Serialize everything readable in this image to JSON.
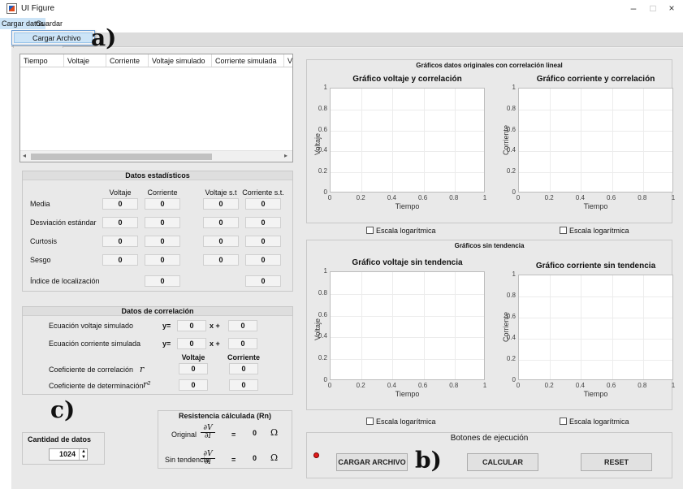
{
  "window": {
    "title": "UI Figure",
    "minimize": "–",
    "maximize": "□",
    "close": "×"
  },
  "menu": {
    "items": [
      "Cargar datos",
      "Guardar"
    ],
    "dropdown_item": "Cargar Archivo"
  },
  "annotations": {
    "a": "a)",
    "b": "b)",
    "c": "c)"
  },
  "table": {
    "columns": [
      "Tiempo",
      "Voltaje",
      "Corriente",
      "Voltaje simulado",
      "Corriente simulada",
      "Vo"
    ]
  },
  "stats": {
    "title": "Datos estadísticos",
    "col_headers": [
      "Voltaje",
      "Corriente",
      "Voltaje s.t",
      "Corriente s.t."
    ],
    "rows": [
      {
        "label": "Media",
        "values": [
          "0",
          "0",
          "0",
          "0"
        ]
      },
      {
        "label": "Desviación estándar",
        "values": [
          "0",
          "0",
          "0",
          "0"
        ]
      },
      {
        "label": "Curtosis",
        "values": [
          "0",
          "0",
          "0",
          "0"
        ]
      },
      {
        "label": "Sesgo",
        "values": [
          "0",
          "0",
          "0",
          "0"
        ]
      },
      {
        "label": "Índice de localización",
        "values": [
          "",
          "0",
          "",
          "0"
        ]
      }
    ]
  },
  "correlation": {
    "title": "Datos de correlación",
    "eq_v_label": "Ecuación voltaje simulado",
    "eq_i_label": "Ecuación corriente simulada",
    "y_eq": "y=",
    "x_plus": "x +",
    "eq_v_values": [
      "0",
      "0"
    ],
    "eq_i_values": [
      "0",
      "0"
    ],
    "col_headers": [
      "Voltaje",
      "Corriente"
    ],
    "coef_corr_label": "Coeficiente de correlación",
    "coef_corr_sym": "r",
    "coef_corr_values": [
      "0",
      "0"
    ],
    "coef_det_label": "Coeficiente de determinación",
    "coef_det_sym": "r²",
    "coef_det_values": [
      "0",
      "0"
    ]
  },
  "quantity": {
    "label": "Cantidad de datos",
    "value": "1024"
  },
  "resistance": {
    "title": "Resistencia cálculada (Rn)",
    "original_label": "Original",
    "sin_tendencia_label": "Sin tendencia",
    "frac_num": "∂V",
    "frac_den": "∂I",
    "equals": "=",
    "original_value": "0",
    "sin_tendencia_value": "0",
    "unit": "Ω"
  },
  "charts_original": {
    "title": "Gráficos datos originales con correlación lineal",
    "log_label": "Escala logarítmica"
  },
  "charts_detrended": {
    "title": "Gráficos sin tendencia",
    "log_label": "Escala logarítmica"
  },
  "chart_data": [
    {
      "type": "line",
      "title": "Gráfico voltaje y correlación",
      "xlabel": "Tiempo",
      "ylabel": "Voltaje",
      "xlim": [
        0,
        1
      ],
      "ylim": [
        0,
        1
      ],
      "xticks": [
        "0",
        "0.2",
        "0.4",
        "0.6",
        "0.8",
        "1"
      ],
      "yticks": [
        "0",
        "0.2",
        "0.4",
        "0.6",
        "0.8",
        "1"
      ],
      "series": []
    },
    {
      "type": "line",
      "title": "Gráfico corriente y correlación",
      "xlabel": "Tiempo",
      "ylabel": "Corriente",
      "xlim": [
        0,
        1
      ],
      "ylim": [
        0,
        1
      ],
      "xticks": [
        "0",
        "0.2",
        "0.4",
        "0.6",
        "0.8",
        "1"
      ],
      "yticks": [
        "0",
        "0.2",
        "0.4",
        "0.6",
        "0.8",
        "1"
      ],
      "series": []
    },
    {
      "type": "line",
      "title": "Gráfico voltaje sin tendencia",
      "xlabel": "Tiempo",
      "ylabel": "Voltaje",
      "xlim": [
        0,
        1
      ],
      "ylim": [
        0,
        1
      ],
      "xticks": [
        "0",
        "0.2",
        "0.4",
        "0.6",
        "0.8",
        "1"
      ],
      "yticks": [
        "0",
        "0.2",
        "0.4",
        "0.6",
        "0.8",
        "1"
      ],
      "series": []
    },
    {
      "type": "line",
      "title": "Gráfico corriente sin tendencia",
      "xlabel": "Tiempo",
      "ylabel": "Corriente",
      "xlim": [
        0,
        1
      ],
      "ylim": [
        0,
        1
      ],
      "xticks": [
        "0",
        "0.2",
        "0.4",
        "0.6",
        "0.8",
        "1"
      ],
      "yticks": [
        "0",
        "0.2",
        "0.4",
        "0.6",
        "0.8",
        "1"
      ],
      "series": []
    }
  ],
  "actions": {
    "title": "Botones de ejecución",
    "load_button": "CARGAR ARCHIVO",
    "calc_button": "CALCULAR",
    "reset_button": "RESET",
    "status_lamp_color": "#e21b1b"
  }
}
